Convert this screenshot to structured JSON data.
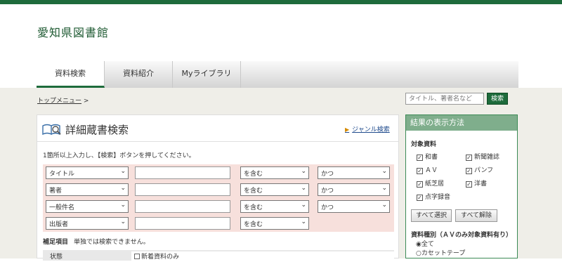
{
  "site": {
    "title": "愛知県図書館"
  },
  "nav": {
    "tabs": [
      "資料検索",
      "資料紹介",
      "Myライブラリ"
    ]
  },
  "breadcrumb": {
    "link": "トップメニュー",
    "sep": ">"
  },
  "quick_search": {
    "placeholder": "タイトル、著者名など",
    "button": "検索"
  },
  "panel": {
    "title": "詳細蔵書検索",
    "genre_link": "ジャンル検索",
    "instruction": "1箇所以上入力し、【検索】ボタンを押してください。",
    "rows": [
      {
        "field": "タイトル",
        "match": "を含む",
        "op": "かつ"
      },
      {
        "field": "著者",
        "match": "を含む",
        "op": "かつ"
      },
      {
        "field": "一般件名",
        "match": "を含む",
        "op": "かつ"
      },
      {
        "field": "出版者",
        "match": "を含む"
      }
    ],
    "supplement_label": "補足項目",
    "supplement_note": "単独では検索できません。",
    "status_label": "状態",
    "new_only": "新着資料のみ"
  },
  "side": {
    "title": "結果の表示方法",
    "target_label": "対象資料",
    "targets": [
      "和書",
      "新聞雑誌",
      "ＡＶ",
      "パンフ",
      "紙芝居",
      "洋書",
      "点字録音"
    ],
    "select_all": "すべて選択",
    "deselect_all": "すべて解除",
    "type_label": "資料種別（ＡＶのみ対象資料有り）",
    "types": [
      "全て",
      "カセットテープ"
    ]
  },
  "colors": {
    "brand": "#1e6b3c",
    "form_bg": "#f7e0dc",
    "side_head": "#7fae8c"
  }
}
